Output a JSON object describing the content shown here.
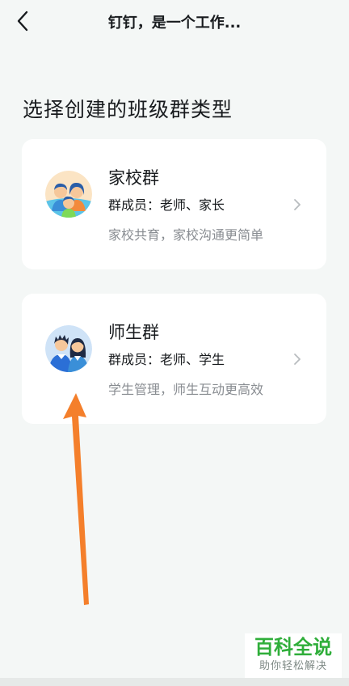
{
  "header": {
    "title": "钉钉，是一个工作..."
  },
  "page": {
    "title": "选择创建的班级群类型"
  },
  "cards": [
    {
      "title": "家校群",
      "members": "群成员：老师、家长",
      "description": "家校共育，家校沟通更简单",
      "icon": "parents-teacher-avatar-icon"
    },
    {
      "title": "师生群",
      "members": "群成员：老师、学生",
      "description": "学生管理，师生互动更高效",
      "icon": "teacher-student-avatar-icon"
    }
  ],
  "watermark": {
    "main": "百科全说",
    "sub": "助你轻松解决"
  },
  "colors": {
    "background": "#f4f7f6",
    "card": "#ffffff",
    "annotation_arrow": "#f47f2b",
    "watermark_green": "#2fae3a"
  }
}
